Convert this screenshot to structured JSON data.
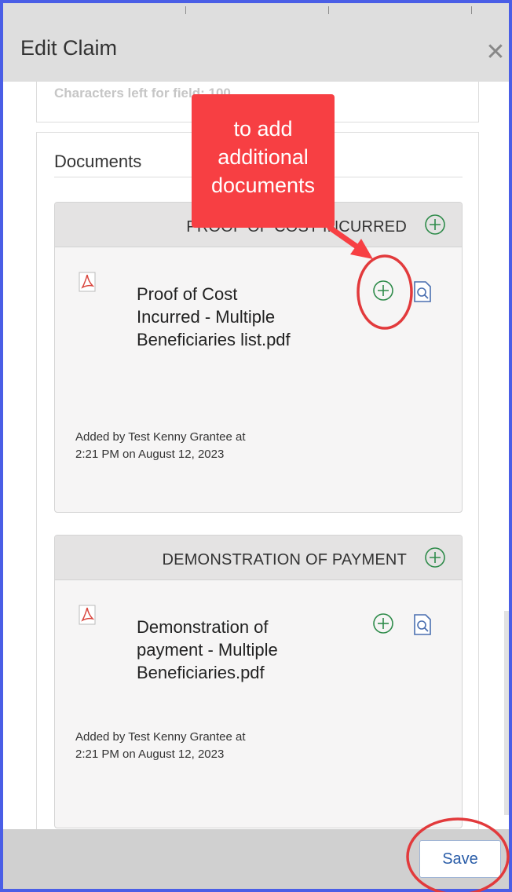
{
  "dialog": {
    "title": "Edit Claim",
    "close_icon": "close-icon"
  },
  "char_counter": {
    "text": "Characters left for field: 100"
  },
  "documents": {
    "title": "Documents",
    "sections": [
      {
        "title": "PROOF OF COST INCURRED",
        "file": {
          "name": "Proof of Cost Incurred - Multiple Beneficiaries list.pdf",
          "icon": "pdf-icon",
          "meta": "Added by Test Kenny Grantee at 2:21 PM on August 12, 2023"
        }
      },
      {
        "title": "DEMONSTRATION OF PAYMENT",
        "file": {
          "name": "Demonstration of payment - Multiple Beneficiaries.pdf",
          "icon": "pdf-icon",
          "meta": "Added by Test Kenny Grantee at 2:21 PM on August 12, 2023"
        }
      }
    ]
  },
  "annotation": {
    "callout_text": "to add additional documents",
    "color": "#f73f43"
  },
  "footer": {
    "save_label": "Save"
  },
  "colors": {
    "frame_border": "#4a5ee6",
    "plus_icon": "#2e8b4a",
    "view_icon": "#4a6fb0",
    "pdf_icon": "#d9453d",
    "save_text": "#2a5da8"
  }
}
